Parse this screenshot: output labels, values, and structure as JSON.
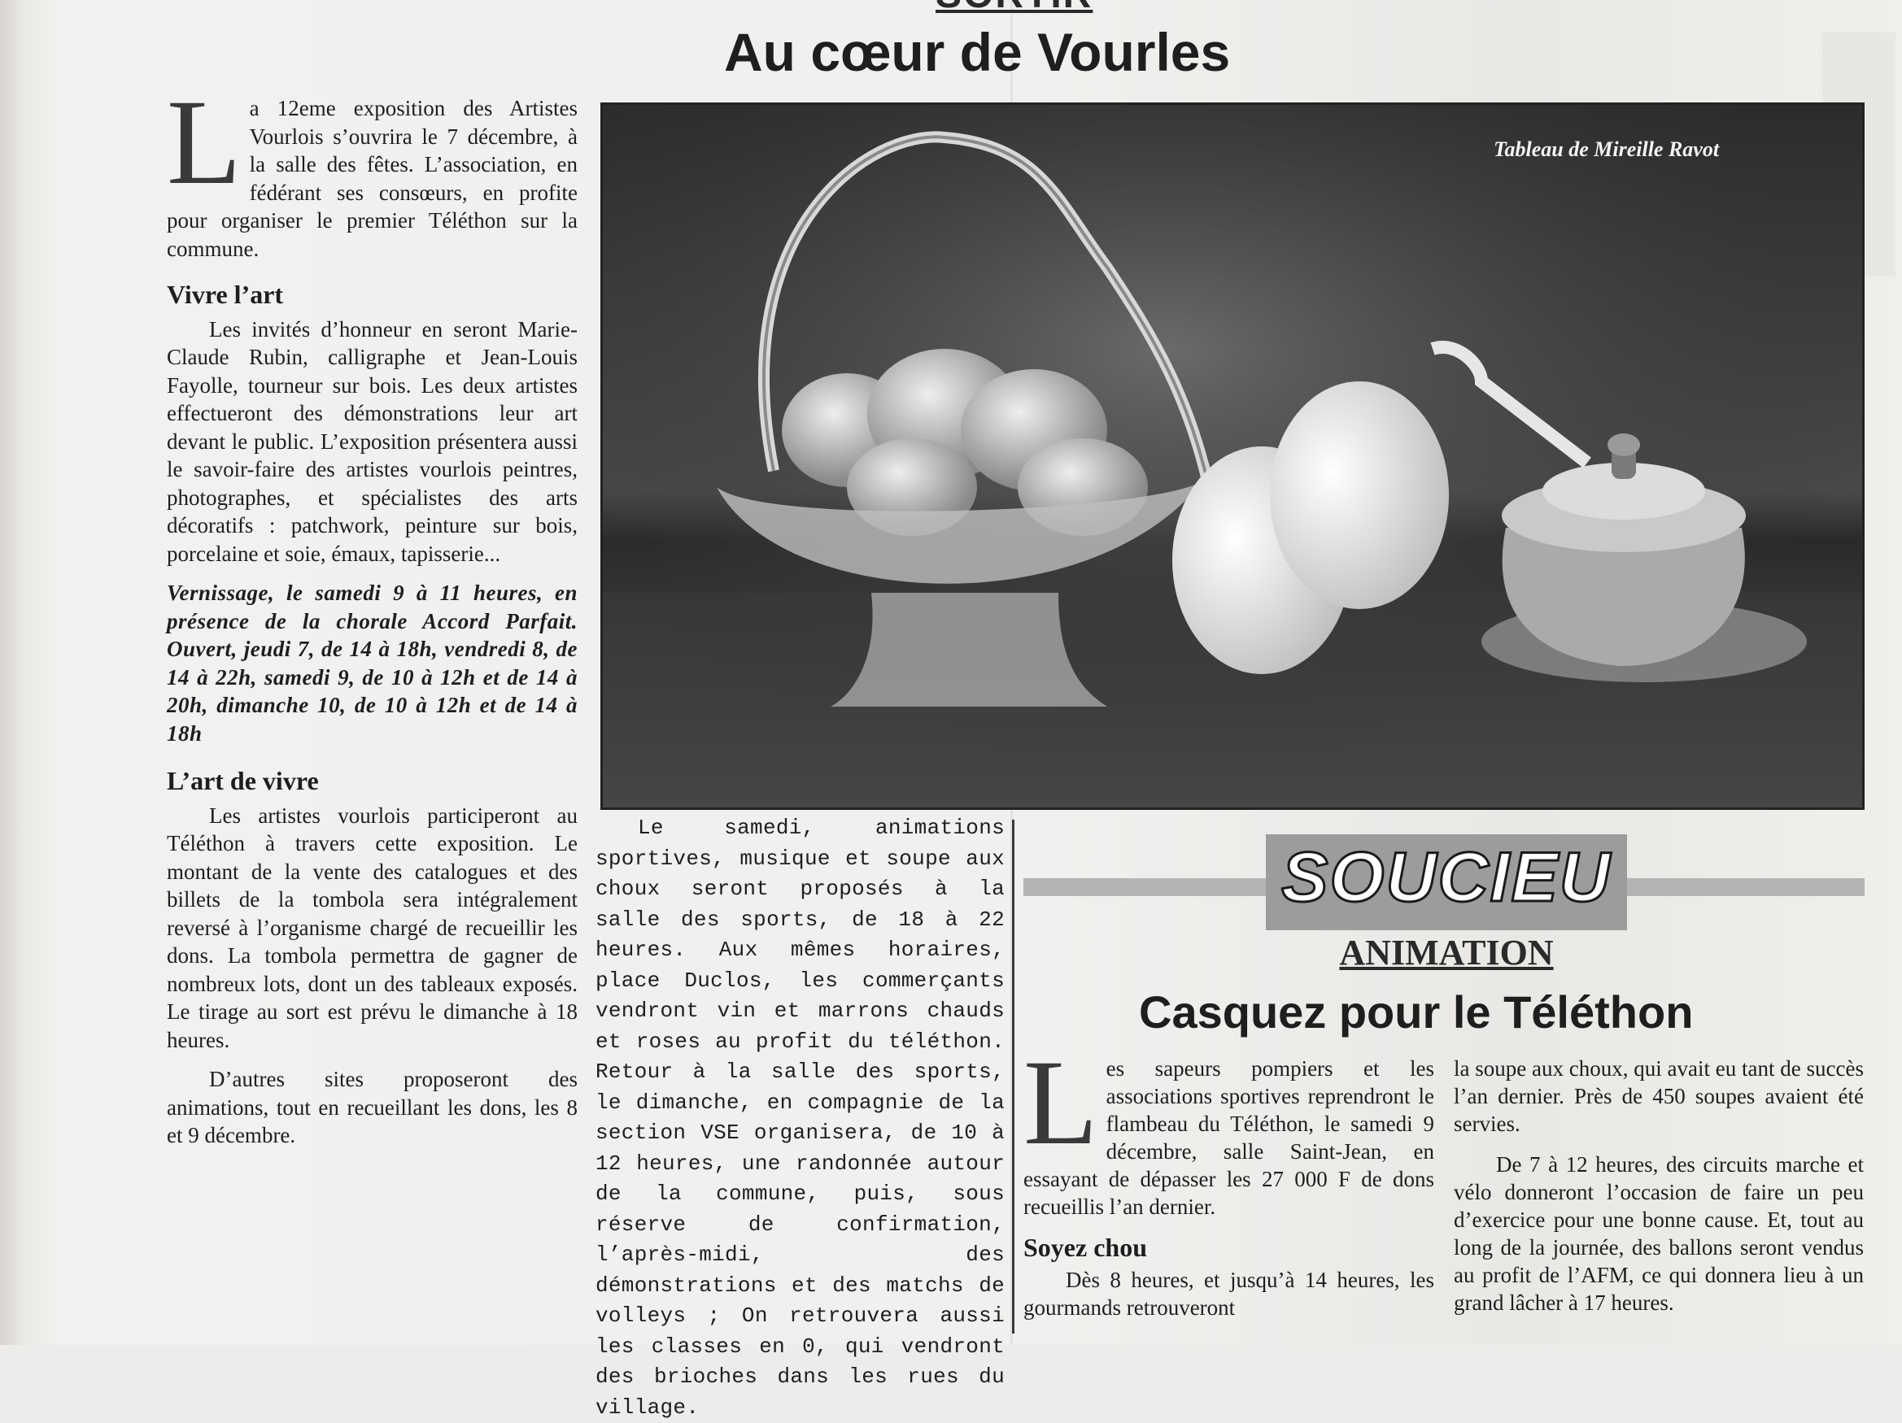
{
  "kicker": "SORTIR",
  "headline": "Au cœur de Vourles",
  "photo": {
    "caption": "Tableau de Mireille Ravot"
  },
  "article1": {
    "dropcap": "L",
    "lead": "a 12eme exposition des Artistes Vourlois s’ouvrira le 7 décembre, à la salle des fêtes. L’association, en fédérant ses consœurs, en profite pour organiser le premier Téléthon sur la commune.",
    "sub1": "Vivre l’art",
    "p1": "Les invités d’honneur en seront Marie-Claude Rubin, calligraphe et Jean-Louis Fayolle, tourneur sur bois. Les deux artistes effectueront des démonstrations leur art devant le public. L’exposition présentera aussi le savoir-faire des artistes vourlois peintres, photographes, et spécialistes des arts décoratifs : patchwork, peinture sur bois, porcelaine et soie, émaux, tapisserie...",
    "italic": "Vernissage, le samedi 9 à 11 heures, en présence de la chorale Accord Parfait. Ouvert, jeudi 7, de 14 à 18h, vendredi 8, de 14 à 22h, samedi 9, de 10 à 12h et de 14 à 20h, dimanche 10, de 10 à 12h et de 14 à 18h",
    "sub2": "L’art de vivre",
    "p2": "Les artistes vourlois participeront au Téléthon à travers cette exposition. Le montant de la vente des catalogues et des billets de la tombola sera intégralement reversé à l’organisme chargé de recueillir les dons. La tombola permettra de gagner de nombreux lots, dont un des tableaux exposés. Le tirage au sort est prévu le dimanche à 18 heures.",
    "p3": "D’autres sites proposeront des animations, tout en recueillant les dons, les 8 et 9 décembre.",
    "p4": "Le samedi, animations sportives, musique et soupe aux choux seront proposés à la salle des sports, de 18 à 22 heures. Aux mêmes horaires, place Duclos, les commerçants vendront vin et marrons chauds et roses au profit du téléthon. Retour à la salle des sports, le dimanche, en compagnie de la section VSE organisera, de 10 à 12 heures, une randonnée autour de la commune, puis, sous réserve de confirmation, l’après-midi, des démonstrations et des matchs de volleys ; On retrouvera aussi les classes en 0, qui vendront des brioches dans les rues du village."
  },
  "article2": {
    "town": "SOUCIEU",
    "section": "ANIMATION",
    "title": "Casquez pour le Téléthon",
    "dropcap": "L",
    "lead": "es sapeurs pompiers et les associations sportives reprendront le flambeau du Téléthon, le samedi 9 décembre, salle Saint-Jean, en essayant de dépasser les 27 000 F de dons recueillis l’an dernier.",
    "sub": "Soyez chou",
    "p1": "Dès 8 heures, et jusqu’à 14 heures, les gourmands retrouveront",
    "p2": "la soupe aux choux, qui avait eu tant de succès l’an dernier. Près de 450 soupes avaient été servies.",
    "p3": "De 7 à 12 heures, des circuits marche et vélo donneront l’occasion de faire un peu d’exercice pour une bonne cause. Et, tout au long de la journée, des ballons seront vendus au profit de l’AFM, ce qui donnera lieu à un grand lâcher à 17 heures."
  }
}
